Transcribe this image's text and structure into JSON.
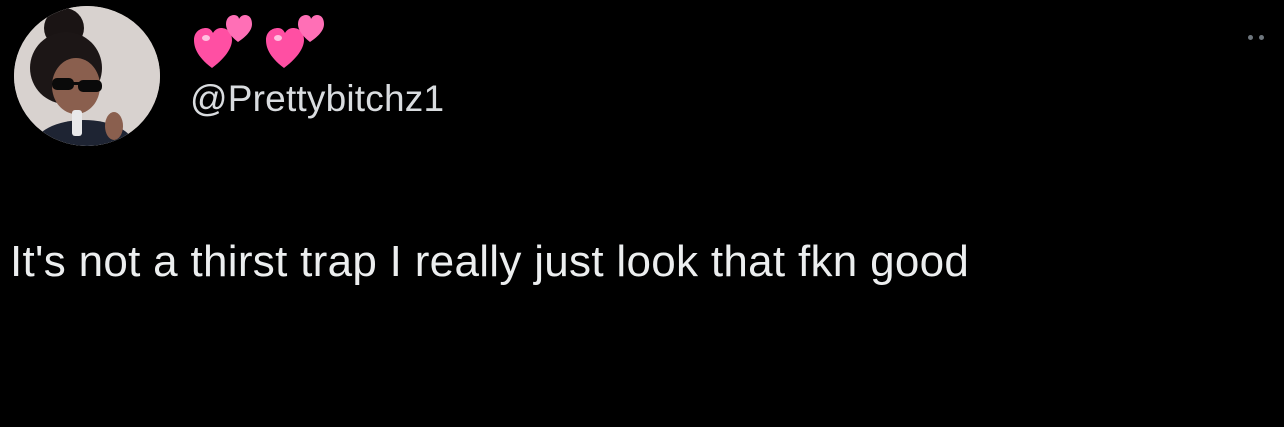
{
  "tweet": {
    "display_name_emoji": [
      "two-hearts-emoji",
      "two-hearts-emoji"
    ],
    "handle": "@Prettybitchz1",
    "text": "It's not a thirst trap I really just look that fkn good",
    "more_icon": "more-dots-icon",
    "accent_color": "#ff4fa3"
  }
}
